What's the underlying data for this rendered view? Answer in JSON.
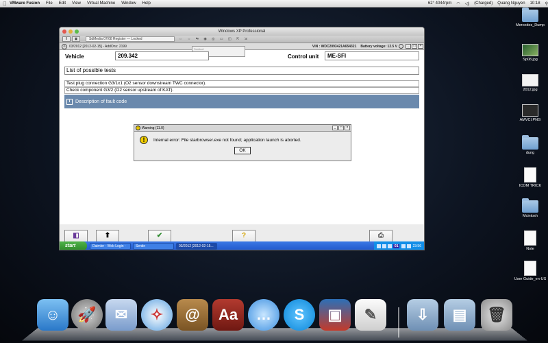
{
  "menubar": {
    "apple": "",
    "items": [
      "VMware Fusion",
      "File",
      "Edit",
      "View",
      "Virtual Machine",
      "Window",
      "Help"
    ],
    "status": {
      "temp": "62° 4044rpm",
      "charge": "(Charged)",
      "user": "Quang Nguyen",
      "time": "10:18"
    }
  },
  "desktop_icons": [
    {
      "label": "Mercedes_Dump",
      "kind": "folder-doc"
    },
    {
      "label": "Sp08.jpg",
      "kind": "thumb-green"
    },
    {
      "label": "2012.jpg",
      "kind": "thumb-white"
    },
    {
      "label": "AMVCI.PNG",
      "kind": "thumb-dark"
    },
    {
      "label": "dung",
      "kind": "folder"
    },
    {
      "label": "ICOM TRICK",
      "kind": "doc"
    },
    {
      "label": "Mcintosh",
      "kind": "folder"
    },
    {
      "label": "Note",
      "kind": "doc"
    },
    {
      "label": "User Guide_en-US",
      "kind": "doc"
    }
  ],
  "vm_window": {
    "title": "Windows XP Professional",
    "toolbar_tab": "SdMedia 07/08 Register — Locked"
  },
  "app": {
    "header_version": "03/2012 [2012-02-15] - AddOns: 2199",
    "vin": "VIN : WDC2093421A654321",
    "battery": "Battery voltage: 12.5 V",
    "sentinel_title": "Sentinel",
    "vehicle_label": "Vehicle",
    "vehicle_value": "209.342",
    "control_unit_label": "Control unit",
    "control_unit_value": "ME-SFI",
    "list_title": "List of possible tests",
    "tests": [
      "Test plug connection G3/1x1 (O2 sensor downstream TWC connector).",
      "Check component G3/2 (O2 sensor upstream of KAT)."
    ],
    "description_bar": "Description of fault code",
    "fkeys": [
      {
        "key": "ESC",
        "icon": "exit-icon"
      },
      {
        "key": "F1",
        "icon": "arrow-up-icon"
      },
      {
        "key": "F3",
        "icon": "checkmark-icon"
      },
      {
        "key": "F6",
        "icon": "help-icon"
      },
      {
        "key": "F11",
        "icon": "printer-icon"
      }
    ]
  },
  "dialog": {
    "title": "Warning   (11.0)",
    "message": "Internal error: File starbrowser.exe not found; application launch is aborted.",
    "ok_label": "OK"
  },
  "taskbar": {
    "start": "start",
    "tasks": [
      "Daimler - Web Login -",
      "Sentin",
      "03/2012 [2012-02-15..."
    ],
    "tray_badge": "01",
    "clock": "23:56"
  },
  "dock": [
    "Finder",
    "Launchpad",
    "Mail",
    "Safari",
    "Address Book",
    "Dictionary",
    "Messages",
    "Skype",
    "VMware Fusion",
    "TextEdit",
    "Downloads",
    "Documents",
    "Trash"
  ]
}
